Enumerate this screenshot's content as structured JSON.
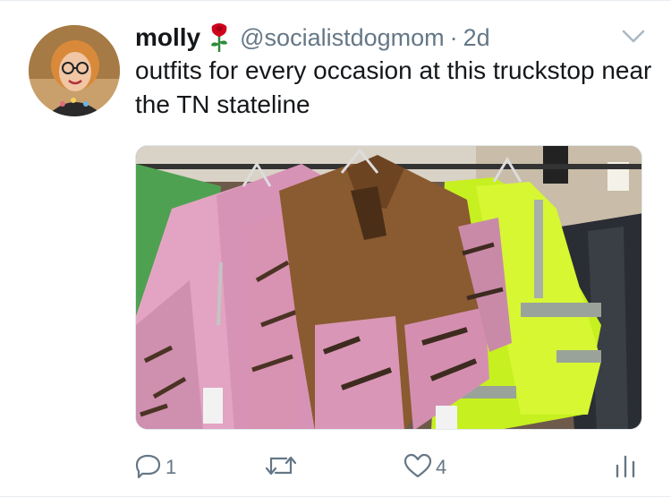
{
  "tweet": {
    "display_name": "molly",
    "name_emoji": "rose-icon",
    "handle": "@socialistdogmom",
    "separator": "·",
    "timestamp": "2d",
    "text": "outfits for every occasion at this truckstop near the TN stateline",
    "media_alt": "camo and safety jackets on a truckstop rack",
    "actions": {
      "reply_count": "1",
      "retweet_count": "",
      "like_count": "4"
    }
  },
  "colors": {
    "text": "#14171a",
    "secondary": "#657786",
    "divider": "#e6ecf0",
    "rose": "#d0021b"
  }
}
